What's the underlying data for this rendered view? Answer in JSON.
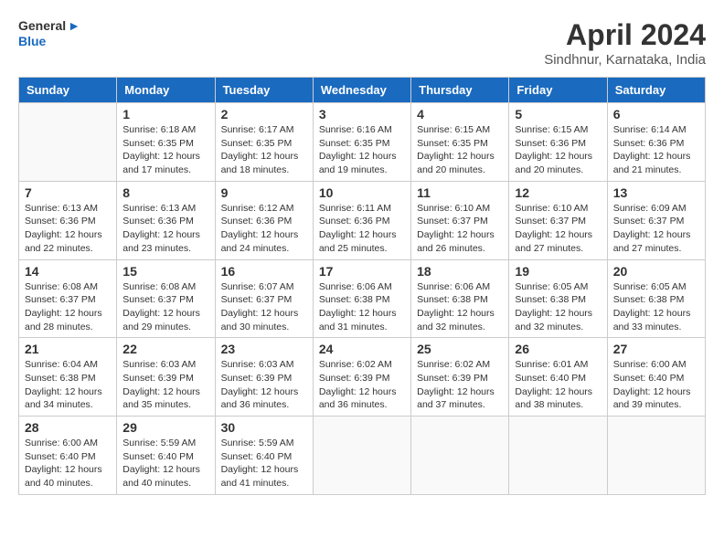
{
  "header": {
    "logo_line1": "General",
    "logo_line2": "Blue",
    "month_title": "April 2024",
    "location": "Sindhnur, Karnataka, India"
  },
  "weekdays": [
    "Sunday",
    "Monday",
    "Tuesday",
    "Wednesday",
    "Thursday",
    "Friday",
    "Saturday"
  ],
  "weeks": [
    [
      {
        "day": "",
        "sunrise": "",
        "sunset": "",
        "daylight": ""
      },
      {
        "day": "1",
        "sunrise": "Sunrise: 6:18 AM",
        "sunset": "Sunset: 6:35 PM",
        "daylight": "Daylight: 12 hours and 17 minutes."
      },
      {
        "day": "2",
        "sunrise": "Sunrise: 6:17 AM",
        "sunset": "Sunset: 6:35 PM",
        "daylight": "Daylight: 12 hours and 18 minutes."
      },
      {
        "day": "3",
        "sunrise": "Sunrise: 6:16 AM",
        "sunset": "Sunset: 6:35 PM",
        "daylight": "Daylight: 12 hours and 19 minutes."
      },
      {
        "day": "4",
        "sunrise": "Sunrise: 6:15 AM",
        "sunset": "Sunset: 6:35 PM",
        "daylight": "Daylight: 12 hours and 20 minutes."
      },
      {
        "day": "5",
        "sunrise": "Sunrise: 6:15 AM",
        "sunset": "Sunset: 6:36 PM",
        "daylight": "Daylight: 12 hours and 20 minutes."
      },
      {
        "day": "6",
        "sunrise": "Sunrise: 6:14 AM",
        "sunset": "Sunset: 6:36 PM",
        "daylight": "Daylight: 12 hours and 21 minutes."
      }
    ],
    [
      {
        "day": "7",
        "sunrise": "Sunrise: 6:13 AM",
        "sunset": "Sunset: 6:36 PM",
        "daylight": "Daylight: 12 hours and 22 minutes."
      },
      {
        "day": "8",
        "sunrise": "Sunrise: 6:13 AM",
        "sunset": "Sunset: 6:36 PM",
        "daylight": "Daylight: 12 hours and 23 minutes."
      },
      {
        "day": "9",
        "sunrise": "Sunrise: 6:12 AM",
        "sunset": "Sunset: 6:36 PM",
        "daylight": "Daylight: 12 hours and 24 minutes."
      },
      {
        "day": "10",
        "sunrise": "Sunrise: 6:11 AM",
        "sunset": "Sunset: 6:36 PM",
        "daylight": "Daylight: 12 hours and 25 minutes."
      },
      {
        "day": "11",
        "sunrise": "Sunrise: 6:10 AM",
        "sunset": "Sunset: 6:37 PM",
        "daylight": "Daylight: 12 hours and 26 minutes."
      },
      {
        "day": "12",
        "sunrise": "Sunrise: 6:10 AM",
        "sunset": "Sunset: 6:37 PM",
        "daylight": "Daylight: 12 hours and 27 minutes."
      },
      {
        "day": "13",
        "sunrise": "Sunrise: 6:09 AM",
        "sunset": "Sunset: 6:37 PM",
        "daylight": "Daylight: 12 hours and 27 minutes."
      }
    ],
    [
      {
        "day": "14",
        "sunrise": "Sunrise: 6:08 AM",
        "sunset": "Sunset: 6:37 PM",
        "daylight": "Daylight: 12 hours and 28 minutes."
      },
      {
        "day": "15",
        "sunrise": "Sunrise: 6:08 AM",
        "sunset": "Sunset: 6:37 PM",
        "daylight": "Daylight: 12 hours and 29 minutes."
      },
      {
        "day": "16",
        "sunrise": "Sunrise: 6:07 AM",
        "sunset": "Sunset: 6:37 PM",
        "daylight": "Daylight: 12 hours and 30 minutes."
      },
      {
        "day": "17",
        "sunrise": "Sunrise: 6:06 AM",
        "sunset": "Sunset: 6:38 PM",
        "daylight": "Daylight: 12 hours and 31 minutes."
      },
      {
        "day": "18",
        "sunrise": "Sunrise: 6:06 AM",
        "sunset": "Sunset: 6:38 PM",
        "daylight": "Daylight: 12 hours and 32 minutes."
      },
      {
        "day": "19",
        "sunrise": "Sunrise: 6:05 AM",
        "sunset": "Sunset: 6:38 PM",
        "daylight": "Daylight: 12 hours and 32 minutes."
      },
      {
        "day": "20",
        "sunrise": "Sunrise: 6:05 AM",
        "sunset": "Sunset: 6:38 PM",
        "daylight": "Daylight: 12 hours and 33 minutes."
      }
    ],
    [
      {
        "day": "21",
        "sunrise": "Sunrise: 6:04 AM",
        "sunset": "Sunset: 6:38 PM",
        "daylight": "Daylight: 12 hours and 34 minutes."
      },
      {
        "day": "22",
        "sunrise": "Sunrise: 6:03 AM",
        "sunset": "Sunset: 6:39 PM",
        "daylight": "Daylight: 12 hours and 35 minutes."
      },
      {
        "day": "23",
        "sunrise": "Sunrise: 6:03 AM",
        "sunset": "Sunset: 6:39 PM",
        "daylight": "Daylight: 12 hours and 36 minutes."
      },
      {
        "day": "24",
        "sunrise": "Sunrise: 6:02 AM",
        "sunset": "Sunset: 6:39 PM",
        "daylight": "Daylight: 12 hours and 36 minutes."
      },
      {
        "day": "25",
        "sunrise": "Sunrise: 6:02 AM",
        "sunset": "Sunset: 6:39 PM",
        "daylight": "Daylight: 12 hours and 37 minutes."
      },
      {
        "day": "26",
        "sunrise": "Sunrise: 6:01 AM",
        "sunset": "Sunset: 6:40 PM",
        "daylight": "Daylight: 12 hours and 38 minutes."
      },
      {
        "day": "27",
        "sunrise": "Sunrise: 6:00 AM",
        "sunset": "Sunset: 6:40 PM",
        "daylight": "Daylight: 12 hours and 39 minutes."
      }
    ],
    [
      {
        "day": "28",
        "sunrise": "Sunrise: 6:00 AM",
        "sunset": "Sunset: 6:40 PM",
        "daylight": "Daylight: 12 hours and 40 minutes."
      },
      {
        "day": "29",
        "sunrise": "Sunrise: 5:59 AM",
        "sunset": "Sunset: 6:40 PM",
        "daylight": "Daylight: 12 hours and 40 minutes."
      },
      {
        "day": "30",
        "sunrise": "Sunrise: 5:59 AM",
        "sunset": "Sunset: 6:40 PM",
        "daylight": "Daylight: 12 hours and 41 minutes."
      },
      {
        "day": "",
        "sunrise": "",
        "sunset": "",
        "daylight": ""
      },
      {
        "day": "",
        "sunrise": "",
        "sunset": "",
        "daylight": ""
      },
      {
        "day": "",
        "sunrise": "",
        "sunset": "",
        "daylight": ""
      },
      {
        "day": "",
        "sunrise": "",
        "sunset": "",
        "daylight": ""
      }
    ]
  ]
}
